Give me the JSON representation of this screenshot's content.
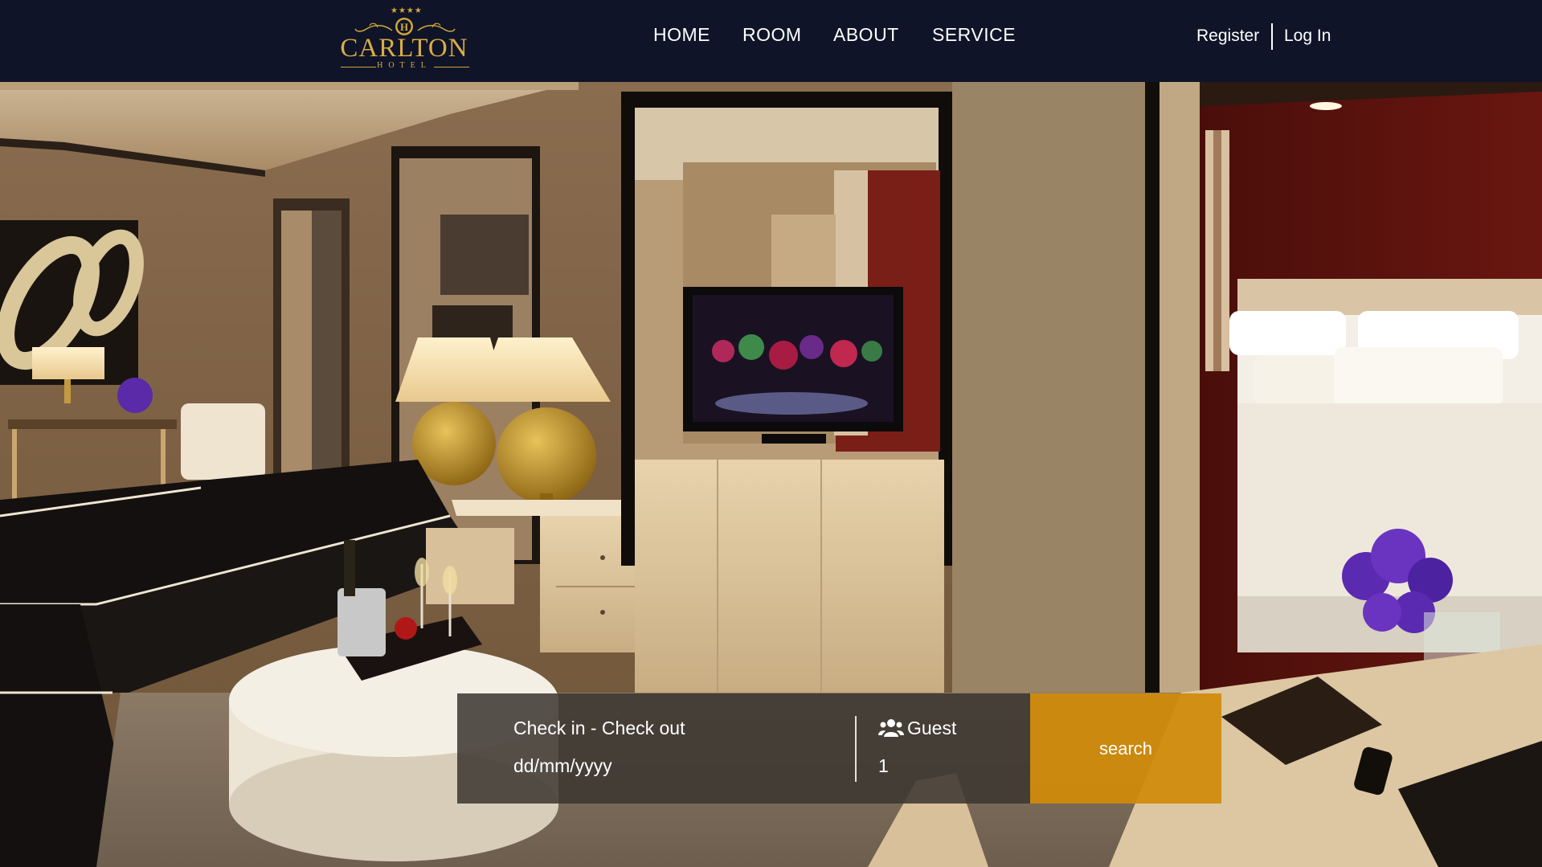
{
  "brand": {
    "stars": "★★★★",
    "monogram": "H",
    "name": "CARLTON",
    "subtitle": "HOTEL"
  },
  "nav": {
    "items": [
      {
        "label": "HOME"
      },
      {
        "label": "ROOM"
      },
      {
        "label": "ABOUT"
      },
      {
        "label": "SERVICE"
      }
    ]
  },
  "auth": {
    "register_label": "Register",
    "login_label": "Log In"
  },
  "hero": {
    "image_description": "luxury hotel suite interior"
  },
  "booking": {
    "dates_label": "Check in - Check out",
    "dates_placeholder": "dd/mm/yyyy",
    "guest_label": "Guest",
    "guest_value": "1",
    "search_label": "search",
    "guest_icon": "users-icon"
  },
  "colors": {
    "header_bg": "#0f1428",
    "brand_gold": "#d9ad45",
    "search_button": "#d18b0a",
    "booking_panel": "#3a3530"
  }
}
